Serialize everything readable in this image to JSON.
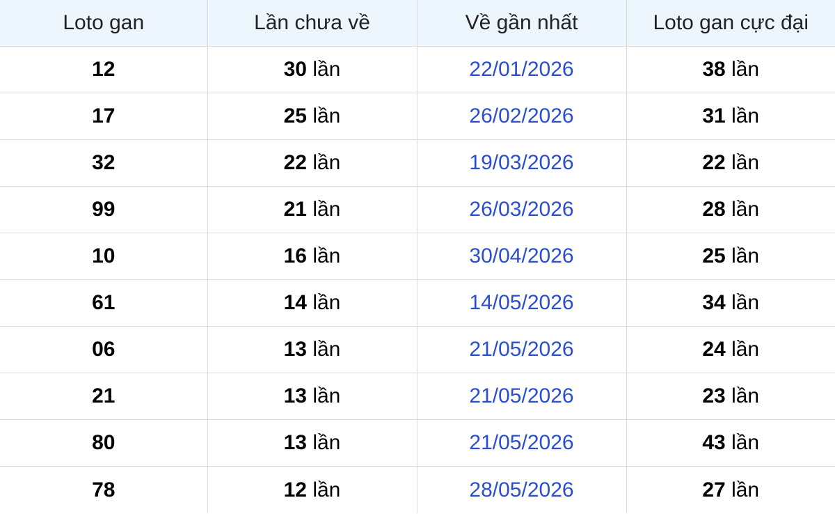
{
  "table": {
    "headers": [
      "Loto gan",
      "Lần chưa về",
      "Về gần nhất",
      "Loto gan cực đại"
    ],
    "unit": "lần",
    "rows": [
      {
        "loto": "12",
        "lan_chua_ve": "30",
        "ve_gan_nhat": "22/01/2026",
        "gan_cuc_dai": "38"
      },
      {
        "loto": "17",
        "lan_chua_ve": "25",
        "ve_gan_nhat": "26/02/2026",
        "gan_cuc_dai": "31"
      },
      {
        "loto": "32",
        "lan_chua_ve": "22",
        "ve_gan_nhat": "19/03/2026",
        "gan_cuc_dai": "22"
      },
      {
        "loto": "99",
        "lan_chua_ve": "21",
        "ve_gan_nhat": "26/03/2026",
        "gan_cuc_dai": "28"
      },
      {
        "loto": "10",
        "lan_chua_ve": "16",
        "ve_gan_nhat": "30/04/2026",
        "gan_cuc_dai": "25"
      },
      {
        "loto": "61",
        "lan_chua_ve": "14",
        "ve_gan_nhat": "14/05/2026",
        "gan_cuc_dai": "34"
      },
      {
        "loto": "06",
        "lan_chua_ve": "13",
        "ve_gan_nhat": "21/05/2026",
        "gan_cuc_dai": "24"
      },
      {
        "loto": "21",
        "lan_chua_ve": "13",
        "ve_gan_nhat": "21/05/2026",
        "gan_cuc_dai": "23"
      },
      {
        "loto": "80",
        "lan_chua_ve": "13",
        "ve_gan_nhat": "21/05/2026",
        "gan_cuc_dai": "43"
      },
      {
        "loto": "78",
        "lan_chua_ve": "12",
        "ve_gan_nhat": "28/05/2026",
        "gan_cuc_dai": "27"
      }
    ]
  },
  "colors": {
    "header_background": "#eef6fd",
    "date_text": "#2a4ecf",
    "border": "#dcdcdc"
  }
}
